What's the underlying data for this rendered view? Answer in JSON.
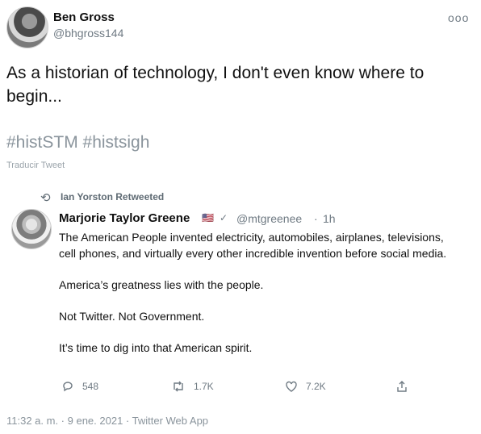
{
  "tweet": {
    "author": {
      "name": "Ben Gross",
      "handle": "@bhgross144"
    },
    "text": "As a historian of technology, I don't even know where to begin...",
    "hashtags": "#histSTM #histsigh",
    "translate_label": "Traducir Tweet",
    "more_label": "ooo",
    "meta": "11:32 a. m. · 9 ene. 2021 · Twitter Web App"
  },
  "retweet": {
    "label": "Ian Yorston Retweeted"
  },
  "quoted": {
    "author": {
      "name": "Marjorie Taylor Greene",
      "badge_flag": "🇺🇸",
      "badge_verified": "✓",
      "handle": "@mtgreenee",
      "time": "1h"
    },
    "paragraphs": [
      "The American People invented electricity, automobiles, airplanes, televisions, cell phones, and virtually every other incredible invention before social media.",
      "America’s greatness lies with the people.",
      "Not Twitter.  Not Government.",
      "It’s time to dig into that American spirit."
    ],
    "actions": {
      "replies": "548",
      "retweets": "1.7K",
      "likes": "7.2K"
    }
  },
  "colors": {
    "text": "#111111",
    "muted": "#6f7a83"
  }
}
